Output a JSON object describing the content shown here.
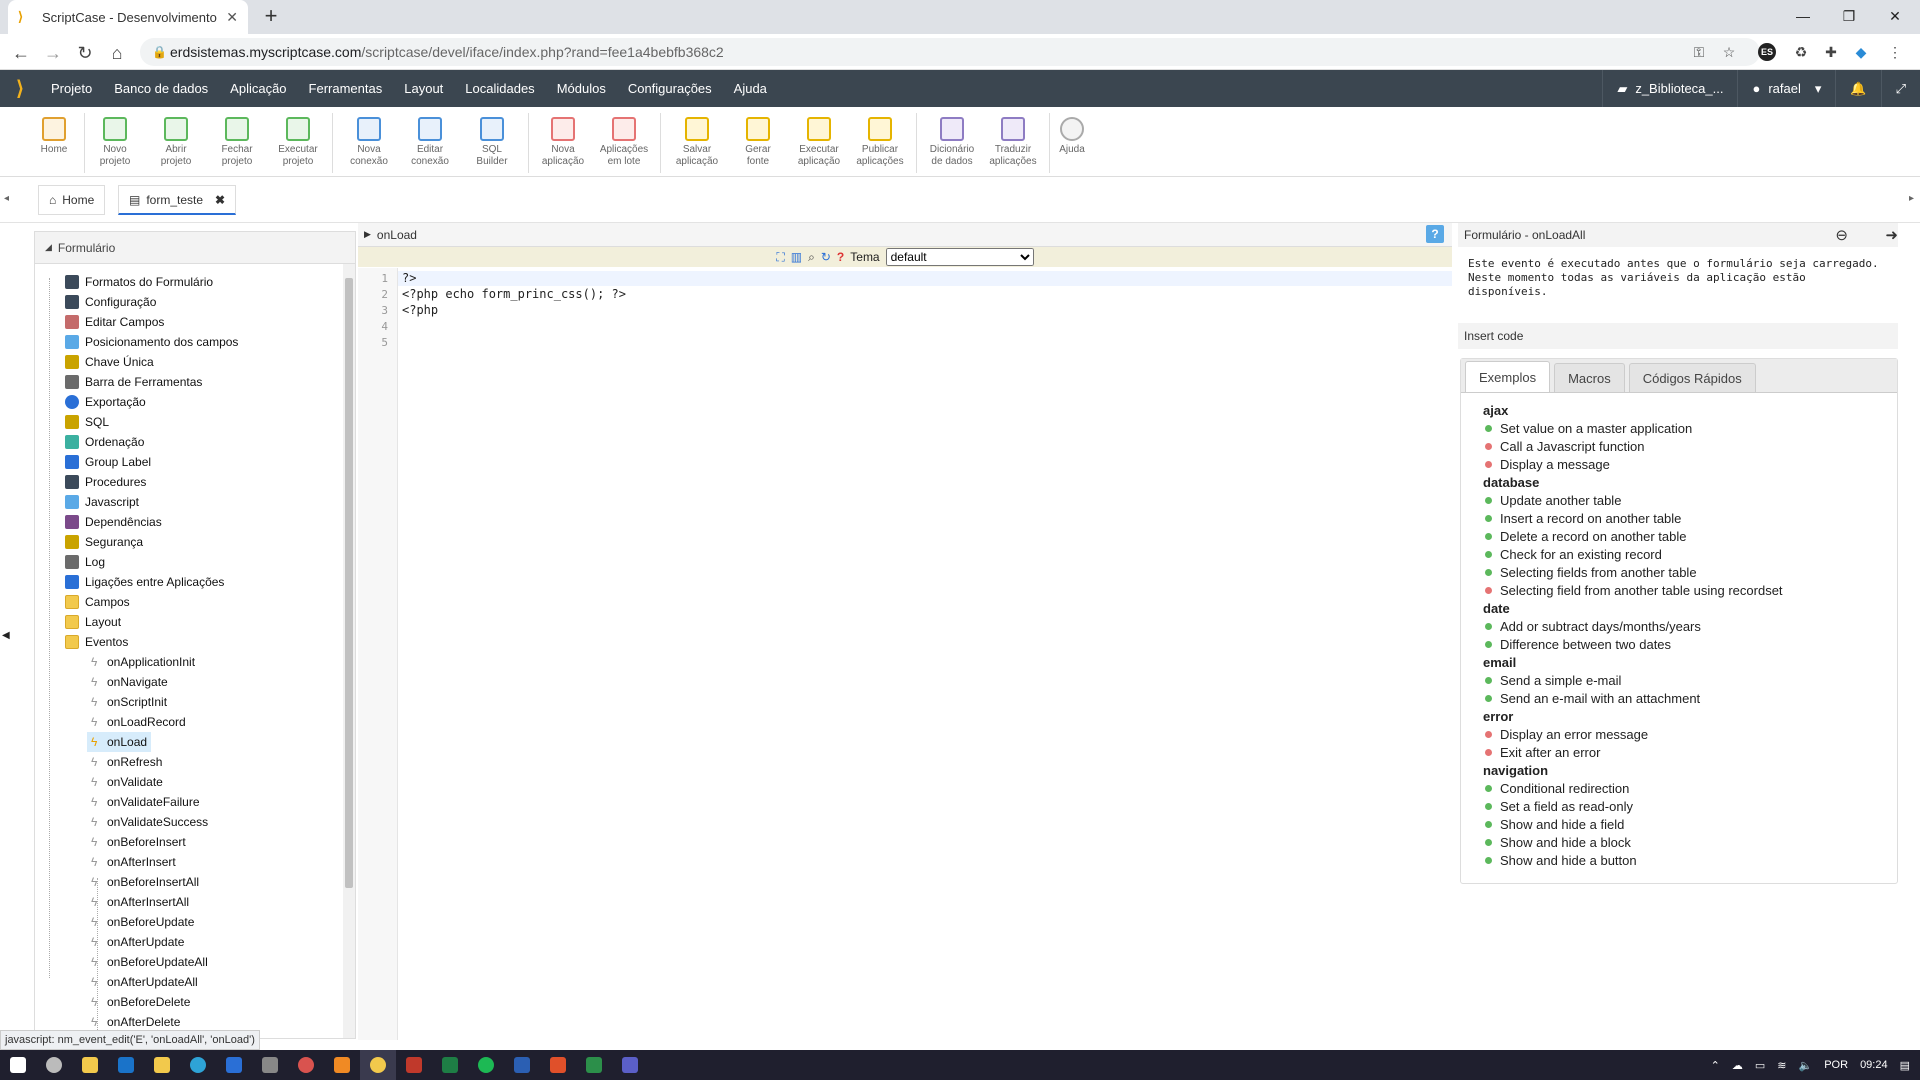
{
  "browser": {
    "tab_title": "ScriptCase - Desenvolvimento -",
    "url_host": "erdsistemas.myscriptcase.com",
    "url_path": "/scriptcase/devel/iface/index.php?rand=fee1a4bebfb368c2",
    "profile_badge": "ES"
  },
  "menubar": {
    "items": [
      "Projeto",
      "Banco de dados",
      "Aplicação",
      "Ferramentas",
      "Layout",
      "Localidades",
      "Módulos",
      "Configurações",
      "Ajuda"
    ],
    "project": "z_Biblioteca_...",
    "user": "rafael"
  },
  "toolbar": [
    {
      "line1": "Home",
      "line2": ""
    },
    {
      "line1": "Novo",
      "line2": "projeto"
    },
    {
      "line1": "Abrir",
      "line2": "projeto"
    },
    {
      "line1": "Fechar",
      "line2": "projeto"
    },
    {
      "line1": "Executar",
      "line2": "projeto"
    },
    {
      "line1": "Nova",
      "line2": "conexão"
    },
    {
      "line1": "Editar",
      "line2": "conexão"
    },
    {
      "line1": "SQL",
      "line2": "Builder"
    },
    {
      "line1": "Nova",
      "line2": "aplicação"
    },
    {
      "line1": "Aplicações",
      "line2": "em lote"
    },
    {
      "line1": "Salvar",
      "line2": "aplicação"
    },
    {
      "line1": "Gerar",
      "line2": "fonte"
    },
    {
      "line1": "Executar",
      "line2": "aplicação"
    },
    {
      "line1": "Publicar",
      "line2": "aplicações"
    },
    {
      "line1": "Dicionário",
      "line2": "de dados"
    },
    {
      "line1": "Traduzir",
      "line2": "aplicações"
    },
    {
      "line1": "Ajuda",
      "line2": ""
    }
  ],
  "app_tabs": {
    "home": "Home",
    "form": "form_teste"
  },
  "tree": {
    "title": "Formulário",
    "items": [
      "Formatos do Formulário",
      "Configuração",
      "Editar Campos",
      "Posicionamento dos campos",
      "Chave Única",
      "Barra de Ferramentas",
      "Exportação",
      "SQL",
      "Ordenação",
      "Group Label",
      "Procedures",
      "Javascript",
      "Dependências",
      "Segurança",
      "Log",
      "Ligações entre Aplicações",
      "Campos",
      "Layout",
      "Eventos"
    ],
    "events": [
      "onApplicationInit",
      "onNavigate",
      "onScriptInit",
      "onLoadRecord",
      "onLoad",
      "onRefresh",
      "onValidate",
      "onValidateFailure",
      "onValidateSuccess",
      "onBeforeInsert",
      "onAfterInsert",
      "onBeforeInsertAll",
      "onAfterInsertAll",
      "onBeforeUpdate",
      "onAfterUpdate",
      "onBeforeUpdateAll",
      "onAfterUpdateAll",
      "onBeforeDelete",
      "onAfterDelete"
    ],
    "selected_event": "onLoad"
  },
  "editor": {
    "title": "onLoad",
    "theme_label": "Tema",
    "theme_value": "default",
    "help": "?",
    "line_numbers": [
      "1",
      "2",
      "3",
      "4",
      "5"
    ],
    "lines": [
      "?>",
      "<?php echo form_princ_css(); ?>",
      "<?php",
      "",
      ""
    ]
  },
  "right_panel": {
    "title": "Formulário - onLoadAll",
    "description": "Este evento é executado antes que o formulário seja carregado.\nNeste momento todas as variáveis da aplicação estão disponíveis.",
    "insert_code": "Insert code",
    "tabs": [
      "Exemplos",
      "Macros",
      "Códigos Rápidos"
    ],
    "categories": [
      {
        "name": "ajax",
        "items": [
          {
            "text": "Set value on a master application",
            "color": "#5cb85c"
          },
          {
            "text": "Call a Javascript function",
            "color": "#e57373"
          },
          {
            "text": "Display a message",
            "color": "#e57373"
          }
        ]
      },
      {
        "name": "database",
        "items": [
          {
            "text": "Update another table",
            "color": "#5cb85c"
          },
          {
            "text": "Insert a record on another table",
            "color": "#5cb85c"
          },
          {
            "text": "Delete a record on another table",
            "color": "#5cb85c"
          },
          {
            "text": "Check for an existing record",
            "color": "#5cb85c"
          },
          {
            "text": "Selecting fields from another table",
            "color": "#5cb85c"
          },
          {
            "text": "Selecting field from another table using recordset",
            "color": "#e57373"
          }
        ]
      },
      {
        "name": "date",
        "items": [
          {
            "text": "Add or subtract days/months/years",
            "color": "#5cb85c"
          },
          {
            "text": "Difference between two dates",
            "color": "#5cb85c"
          }
        ]
      },
      {
        "name": "email",
        "items": [
          {
            "text": "Send a simple e-mail",
            "color": "#5cb85c"
          },
          {
            "text": "Send an e-mail with an attachment",
            "color": "#5cb85c"
          }
        ]
      },
      {
        "name": "error",
        "items": [
          {
            "text": "Display an error message",
            "color": "#e57373"
          },
          {
            "text": "Exit after an error",
            "color": "#e57373"
          }
        ]
      },
      {
        "name": "navigation",
        "items": [
          {
            "text": "Conditional redirection",
            "color": "#5cb85c"
          },
          {
            "text": "Set a field as read-only",
            "color": "#5cb85c"
          },
          {
            "text": "Show and hide a field",
            "color": "#5cb85c"
          },
          {
            "text": "Show and hide a block",
            "color": "#5cb85c"
          },
          {
            "text": "Show and hide a button",
            "color": "#5cb85c"
          }
        ]
      }
    ]
  },
  "statusbar": "javascript: nm_event_edit('E', 'onLoadAll', 'onLoad')",
  "tray": {
    "lang": "POR",
    "time": "09:24"
  }
}
